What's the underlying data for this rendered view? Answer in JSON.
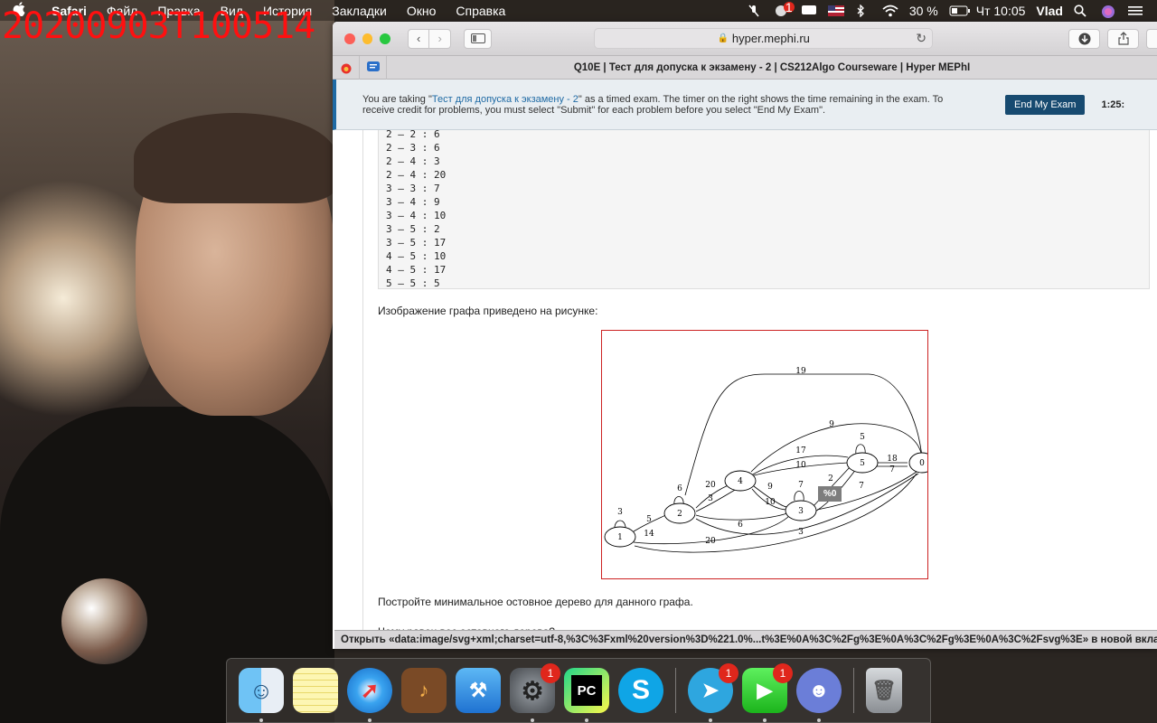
{
  "overlay": {
    "timestamp": "20200903T100514"
  },
  "menubar": {
    "app_name": "Safari",
    "items": [
      "Файл",
      "Правка",
      "Вид",
      "История",
      "Закладки",
      "Окно",
      "Справка"
    ],
    "mail_badge": "1",
    "battery": "30 %",
    "clock": "Чт 10:05",
    "user": "Vlad"
  },
  "browser": {
    "url": "hyper.mephi.ru",
    "tab_title": "Q10E | Тест для допуска к экзамену - 2 | CS212Algo Courseware | Hyper MEPhI"
  },
  "exam": {
    "text_before": "You are taking \"",
    "exam_link": "Тест для допуска к экзамену - 2",
    "text_after": "\" as a timed exam. The timer on the right shows the time remaining in the exam. To receive credit for problems, you must select \"Submit\" for each problem before you select \"End My Exam\".",
    "end_button": "End My Exam",
    "timer": "1:25:"
  },
  "edges_list": [
    "2 – 2 : 6",
    "2 – 3 : 6",
    "2 – 4 : 3",
    "2 – 4 : 20",
    "3 – 3 : 7",
    "3 – 4 : 9",
    "3 – 4 : 10",
    "3 – 5 : 2",
    "3 – 5 : 17",
    "4 – 5 : 10",
    "4 – 5 : 17",
    "5 – 5 : 5"
  ],
  "graph_caption": "Изображение графа приведено на рисунке:",
  "graph": {
    "nodes": [
      "1",
      "2",
      "4",
      "3",
      "5",
      "0"
    ],
    "edge_labels": [
      "19",
      "9",
      "17",
      "10",
      "5",
      "18",
      "7",
      "6",
      "20",
      "3",
      "9",
      "10",
      "7",
      "2",
      "7",
      "3",
      "5",
      "14",
      "6",
      "20",
      "3"
    ]
  },
  "tooltip": "%0",
  "task_text": "Постройте минимальное остовное дерево для данного графа.",
  "question_text": "Чему равен вес остовного дерева?",
  "status_bar": "Открыть «data:image/svg+xml;charset=utf-8,%3C%3Fxml%20version%3D%221.0%...t%3E%0A%3C%2Fg%3E%0A%3C%2Fg%3E%0A%3C%2Fsvg%3E» в новой вкладке",
  "dock": {
    "apps": [
      {
        "name": "Finder"
      },
      {
        "name": "Notes"
      },
      {
        "name": "Safari"
      },
      {
        "name": "GarageBand"
      },
      {
        "name": "Xcode"
      },
      {
        "name": "System Preferences",
        "badge": "1"
      },
      {
        "name": "PyCharm"
      },
      {
        "name": "Skype"
      },
      {
        "name": "Telegram",
        "badge": "1"
      },
      {
        "name": "FaceTime",
        "badge": "1"
      },
      {
        "name": "Discord"
      },
      {
        "name": "Trash"
      }
    ],
    "pycharm_label": "PC"
  }
}
